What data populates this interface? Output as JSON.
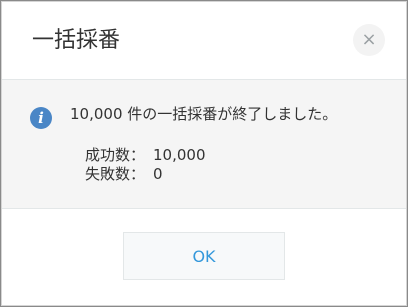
{
  "dialog": {
    "title": "一括採番",
    "close_icon": "close-icon",
    "close_glyph": "×"
  },
  "message": {
    "icon": "info-icon",
    "icon_glyph": "i",
    "icon_color": "#4a86c6",
    "text": "10,000 件の一括採番が終了しました。"
  },
  "stats": {
    "success_label": "成功数：",
    "success_value": "10,000",
    "failure_label": "失敗数：",
    "failure_value": "0"
  },
  "footer": {
    "ok_label": "OK",
    "ok_color": "#3498db"
  }
}
